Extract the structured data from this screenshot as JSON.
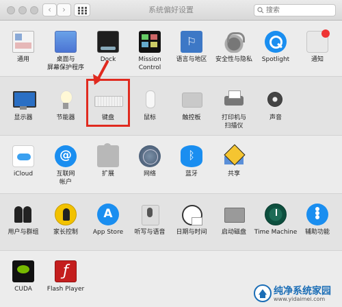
{
  "window": {
    "title": "系统偏好设置"
  },
  "toolbar": {
    "back": "‹",
    "forward": "›"
  },
  "search": {
    "placeholder": "搜索"
  },
  "rows": [
    {
      "items": [
        {
          "label": "通用",
          "icon": "general-icon"
        },
        {
          "label": "桌面与\n屏幕保护程序",
          "icon": "desktop-screensaver-icon"
        },
        {
          "label": "Dock",
          "icon": "dock-icon"
        },
        {
          "label": "Mission\nControl",
          "icon": "mission-control-icon"
        },
        {
          "label": "语言与地区",
          "icon": "language-region-icon"
        },
        {
          "label": "安全性与隐私",
          "icon": "security-privacy-icon"
        },
        {
          "label": "Spotlight",
          "icon": "spotlight-icon"
        },
        {
          "label": "通知",
          "icon": "notifications-icon"
        }
      ]
    },
    {
      "items": [
        {
          "label": "显示器",
          "icon": "display-icon"
        },
        {
          "label": "节能器",
          "icon": "energy-saver-icon"
        },
        {
          "label": "键盘",
          "icon": "keyboard-icon"
        },
        {
          "label": "鼠标",
          "icon": "mouse-icon"
        },
        {
          "label": "触控板",
          "icon": "trackpad-icon"
        },
        {
          "label": "打印机与\n扫描仪",
          "icon": "printer-scanner-icon"
        },
        {
          "label": "声音",
          "icon": "sound-icon"
        }
      ]
    },
    {
      "items": [
        {
          "label": "iCloud",
          "icon": "icloud-icon"
        },
        {
          "label": "互联网\n帐户",
          "icon": "internet-accounts-icon"
        },
        {
          "label": "扩展",
          "icon": "extensions-icon"
        },
        {
          "label": "网络",
          "icon": "network-icon"
        },
        {
          "label": "蓝牙",
          "icon": "bluetooth-icon"
        },
        {
          "label": "共享",
          "icon": "sharing-icon"
        }
      ]
    },
    {
      "items": [
        {
          "label": "用户与群组",
          "icon": "users-groups-icon"
        },
        {
          "label": "家长控制",
          "icon": "parental-controls-icon"
        },
        {
          "label": "App Store",
          "icon": "app-store-icon"
        },
        {
          "label": "听写与语音",
          "icon": "dictation-speech-icon"
        },
        {
          "label": "日期与时间",
          "icon": "date-time-icon"
        },
        {
          "label": "启动磁盘",
          "icon": "startup-disk-icon"
        },
        {
          "label": "Time Machine",
          "icon": "time-machine-icon"
        },
        {
          "label": "辅助功能",
          "icon": "accessibility-icon"
        }
      ]
    },
    {
      "items": [
        {
          "label": "CUDA",
          "icon": "cuda-icon"
        },
        {
          "label": "Flash Player",
          "icon": "flash-player-icon"
        }
      ]
    }
  ],
  "annotation": {
    "color": "#e02a1f"
  },
  "watermark": {
    "title": "纯净系统家园",
    "url": "www.yidaimei.com"
  }
}
